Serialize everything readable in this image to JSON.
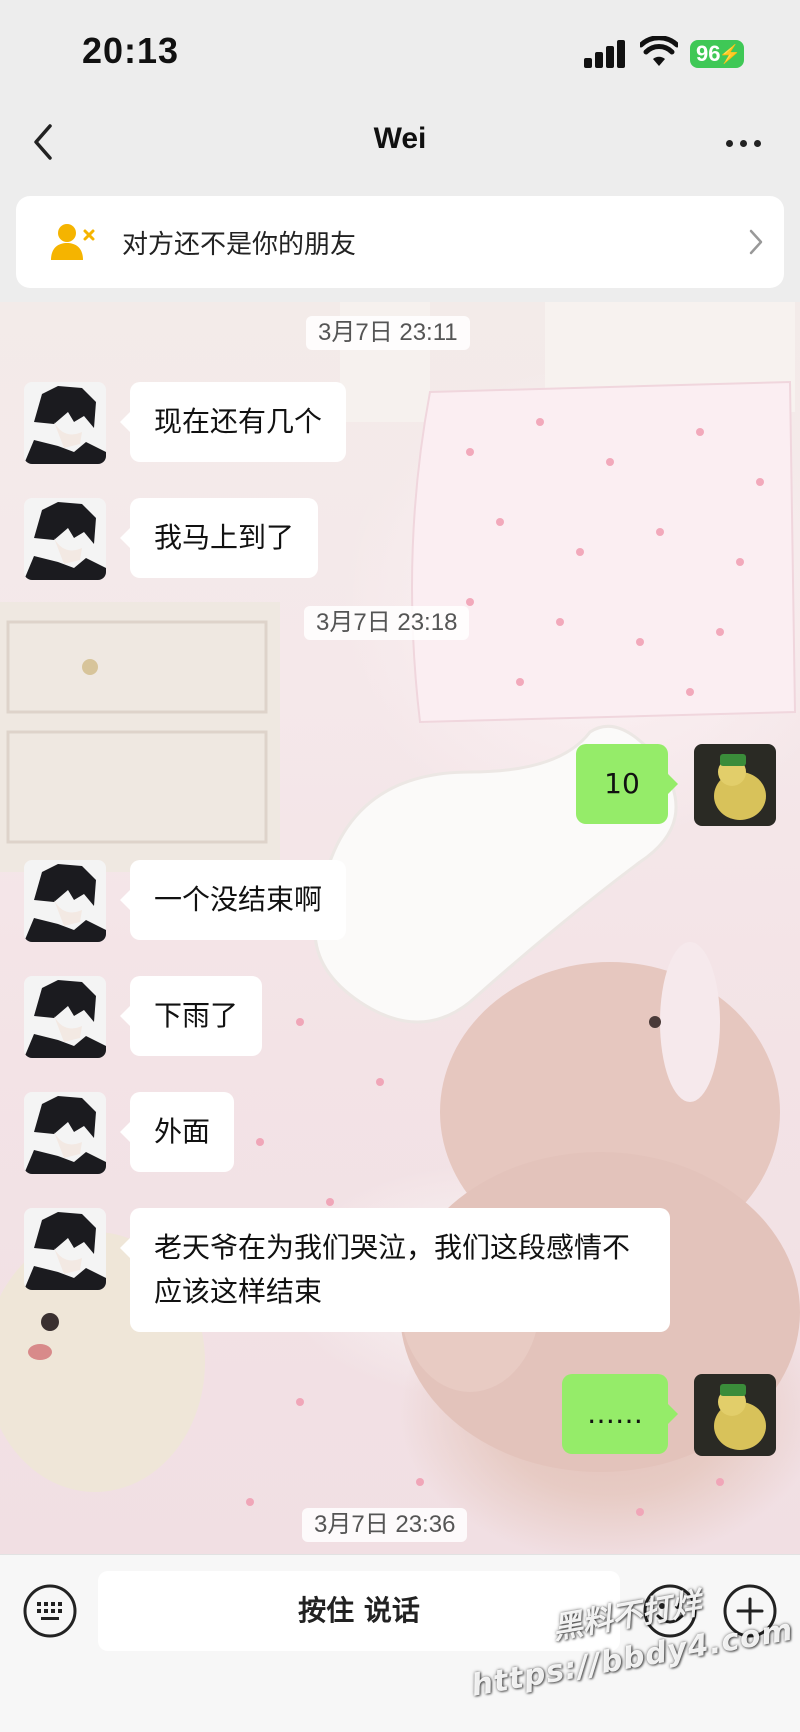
{
  "status_bar": {
    "time": "20:13",
    "battery": "96",
    "icons": [
      "signal-icon",
      "wifi-icon",
      "battery-icon"
    ]
  },
  "nav": {
    "title": "Wei",
    "back_icon": "chevron-left-icon",
    "more_icon": "ellipsis-icon"
  },
  "friend_notice": {
    "text": "对方还不是你的朋友",
    "icon": "user-x-icon",
    "accent": "#f5b400"
  },
  "chat": {
    "timestamps": [
      "3月7日 23:11",
      "3月7日 23:18",
      "3月7日 23:36"
    ],
    "messages": [
      {
        "from": "other",
        "text": "现在还有几个"
      },
      {
        "from": "other",
        "text": "我马上到了"
      },
      {
        "from": "me",
        "text": "10"
      },
      {
        "from": "other",
        "text": "一个没结束啊"
      },
      {
        "from": "other",
        "text": "下雨了"
      },
      {
        "from": "other",
        "text": "外面"
      },
      {
        "from": "other",
        "text": "老天爷在为我们哭泣，我们这段感情不应该这样结束"
      },
      {
        "from": "me",
        "text": "……"
      }
    ],
    "bubble_colors": {
      "other": "#ffffff",
      "me": "#95ec69"
    }
  },
  "input_bar": {
    "hold_to_talk": "按住 说话",
    "left_icon": "keyboard-icon",
    "right_icons": [
      "emoji-icon",
      "plus-icon"
    ]
  },
  "watermark": {
    "line1": "黑料不打烊",
    "line2": "https://bbdy4.com"
  }
}
